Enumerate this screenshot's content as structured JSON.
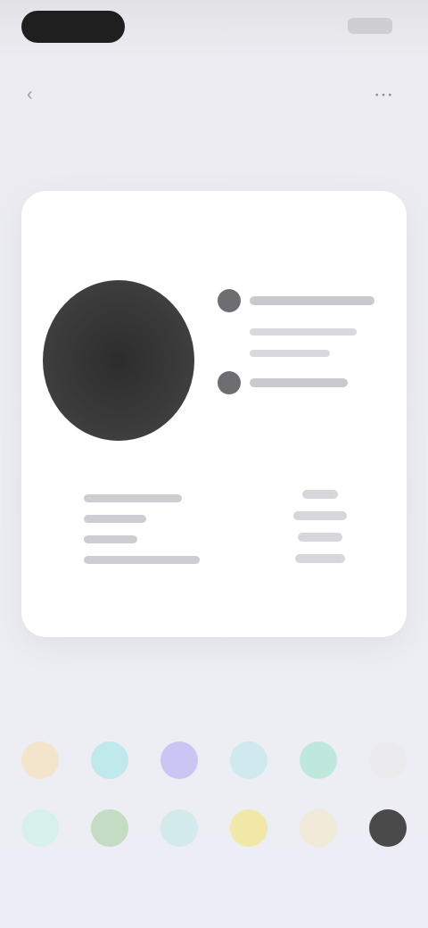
{
  "colors": {
    "background": "#ededf5",
    "card": "#ffffff",
    "clock_face": "#333333"
  },
  "icons": {
    "back": "chevron-left-icon",
    "action": "more-icon"
  },
  "swatches": {
    "row1": [
      "#f3e4cc",
      "#bfe9ea",
      "#c9c6f3",
      "#cfe9ef",
      "#bfe8dd",
      "#ebebee"
    ],
    "row2": [
      "#d8f0ec",
      "#c4dcc3",
      "#d2eaea",
      "#f1e8a8",
      "#f1ead8",
      "#4a4a4a"
    ]
  }
}
